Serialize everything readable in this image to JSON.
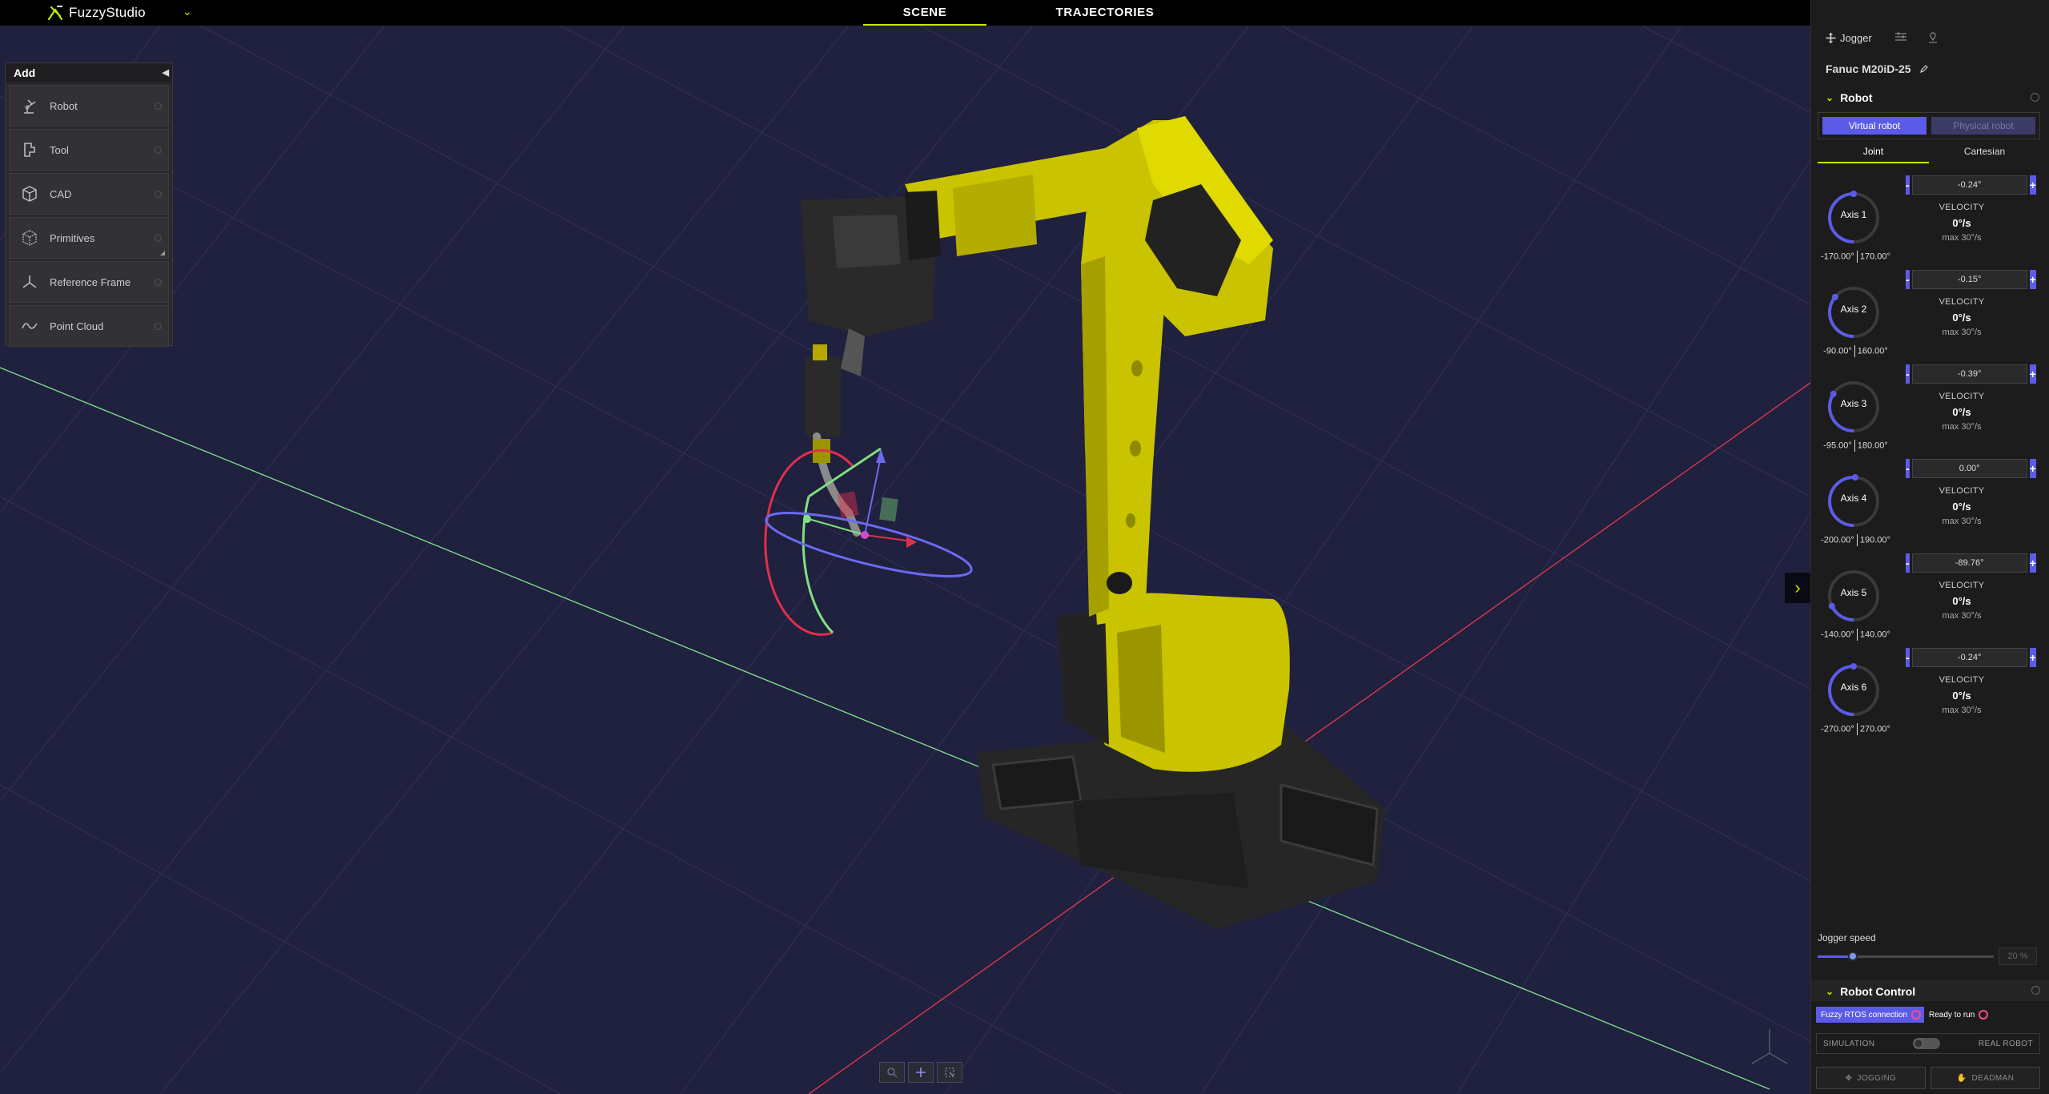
{
  "app": {
    "brand": "FuzzyStudio"
  },
  "top_tabs": [
    "SCENE",
    "TRAJECTORIES"
  ],
  "add_panel": {
    "title": "Add",
    "items": [
      {
        "label": "Robot",
        "icon": "robot-arm-icon"
      },
      {
        "label": "Tool",
        "icon": "tool-icon"
      },
      {
        "label": "CAD",
        "icon": "cube-icon"
      },
      {
        "label": "Primitives",
        "icon": "primitives-icon"
      },
      {
        "label": "Reference Frame",
        "icon": "axes-icon"
      },
      {
        "label": "Point Cloud",
        "icon": "wave-icon"
      }
    ]
  },
  "right_panel": {
    "tabs": {
      "jogger": "Jogger"
    },
    "robot_name": "Fanuc M20iD-25",
    "robot_section": "Robot",
    "modes": {
      "virtual": "Virtual robot",
      "physical": "Physical robot"
    },
    "jog_tabs": {
      "joint": "Joint",
      "cartesian": "Cartesian"
    },
    "velocity_title": "VELOCITY",
    "axes": [
      {
        "label": "Axis 1",
        "value": "-0.24°",
        "min": "-170.00°",
        "max": "170.00°",
        "velocity": "0°/s",
        "max_velocity": "max 30°/s",
        "fraction": 0.5
      },
      {
        "label": "Axis 2",
        "value": "-0.15°",
        "min": "-90.00°",
        "max": "160.00°",
        "velocity": "0°/s",
        "max_velocity": "max 30°/s",
        "fraction": 0.36
      },
      {
        "label": "Axis 3",
        "value": "-0.39°",
        "min": "-95.00°",
        "max": "180.00°",
        "velocity": "0°/s",
        "max_velocity": "max 30°/s",
        "fraction": 0.34
      },
      {
        "label": "Axis 4",
        "value": "0.00°",
        "min": "-200.00°",
        "max": "190.00°",
        "velocity": "0°/s",
        "max_velocity": "max 30°/s",
        "fraction": 0.51
      },
      {
        "label": "Axis 5",
        "value": "-89.76°",
        "min": "-140.00°",
        "max": "140.00°",
        "velocity": "0°/s",
        "max_velocity": "max 30°/s",
        "fraction": 0.18
      },
      {
        "label": "Axis 6",
        "value": "-0.24°",
        "min": "-270.00°",
        "max": "270.00°",
        "velocity": "0°/s",
        "max_velocity": "max 30°/s",
        "fraction": 0.5
      }
    ],
    "jogger_speed": {
      "label": "Jogger speed",
      "value": "20 %",
      "fraction": 0.2
    },
    "robot_control": {
      "title": "Robot Control",
      "rtos": "Fuzzy RTOS connection",
      "ready": "Ready to run",
      "simulation": "SIMULATION",
      "real_robot": "REAL ROBOT",
      "jogging": "JOGGING",
      "deadman": "DEADMAN"
    }
  },
  "colors": {
    "accent": "#c8e600",
    "primary": "#5b5be8",
    "scene_bg": "#20203f",
    "robot_yellow": "#c9c300"
  }
}
